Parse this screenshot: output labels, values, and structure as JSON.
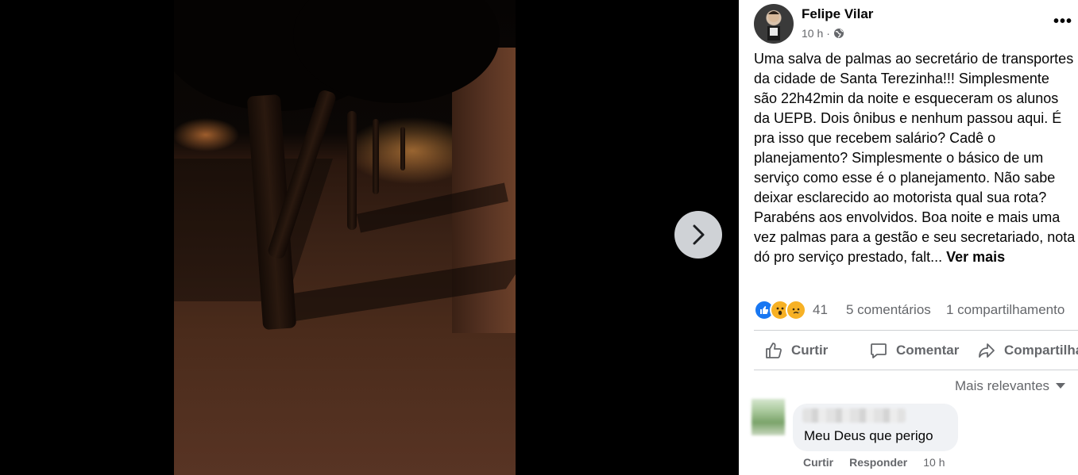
{
  "post": {
    "author": "Felipe Vilar",
    "time": "10 h",
    "separator": "·",
    "privacy_icon": "globe-icon",
    "options_label": "•••",
    "text": "Uma salva de palmas ao secretário de transportes\nda cidade de Santa Terezinha!!! Simplesmente\nsão 22h42min da noite e esqueceram os alunos\nda UEPB. Dois ônibus e nenhum passou aqui. É\npra isso que recebem salário? Cadê o\nplanejamento? Simplesmente o básico de um\nserviço como esse é o planejamento. Não sabe\ndeixar esclarecido ao motorista qual sua rota?\nParabéns aos envolvidos. Boa noite e mais uma\nvez palmas para a gestão e seu secretariado, nota\ndó pro serviço prestado, falt... ",
    "see_more": "Ver mais"
  },
  "stats": {
    "reaction_icons": [
      "like-icon",
      "wow-icon",
      "sad-icon"
    ],
    "reactions_count": "41",
    "comments": "5 comentários",
    "shares": "1 compartilhamento"
  },
  "actions": {
    "like": "Curtir",
    "comment": "Comentar",
    "share": "Compartilhar"
  },
  "sort": {
    "label": "Mais relevantes"
  },
  "comment": {
    "text": "Meu Deus que perigo",
    "like": "Curtir",
    "reply": "Responder",
    "time": "10 h"
  },
  "colors": {
    "like_blue": "#1877f2",
    "wow_yellow": "#f7b125",
    "secondary_text": "#65676b",
    "bubble_bg": "#f0f2f5"
  }
}
